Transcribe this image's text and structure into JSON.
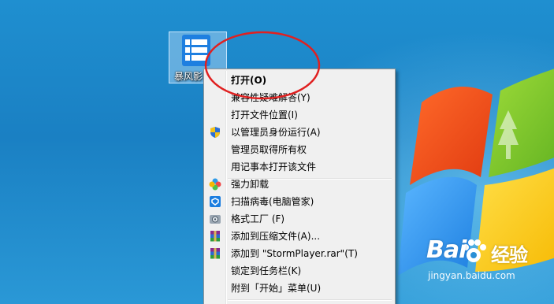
{
  "desktop_icon": {
    "label": "暴风影"
  },
  "context_menu": {
    "items": [
      {
        "label": "打开(O)",
        "bold": true,
        "icon": ""
      },
      {
        "label": "兼容性疑难解答(Y)",
        "icon": ""
      },
      {
        "label": "打开文件位置(I)",
        "icon": ""
      },
      {
        "label": "以管理员身份运行(A)",
        "icon": "uac-shield-icon"
      },
      {
        "label": "管理员取得所有权",
        "icon": ""
      },
      {
        "label": "用记事本打开该文件",
        "icon": ""
      },
      {
        "label": "强力卸载",
        "icon": "uninstall-flower-icon"
      },
      {
        "label": "扫描病毒(电脑管家)",
        "icon": "pc-manager-shield-icon"
      },
      {
        "label": "格式工厂 (F)",
        "icon": "format-factory-icon"
      },
      {
        "label": "添加到压缩文件(A)...",
        "icon": "winrar-icon"
      },
      {
        "label": "添加到 \"StormPlayer.rar\"(T)",
        "icon": "winrar-icon"
      },
      {
        "label": "锁定到任务栏(K)",
        "icon": ""
      },
      {
        "label": "附到「开始」菜单(U)",
        "icon": ""
      }
    ]
  },
  "watermark": {
    "brand": "Bai",
    "brand2": "经验",
    "url": "jingyan.baidu.com"
  },
  "colors": {
    "desktop_blue": "#1a86c8",
    "menu_bg": "#f0f0f0",
    "annotation_red": "#e02020"
  }
}
